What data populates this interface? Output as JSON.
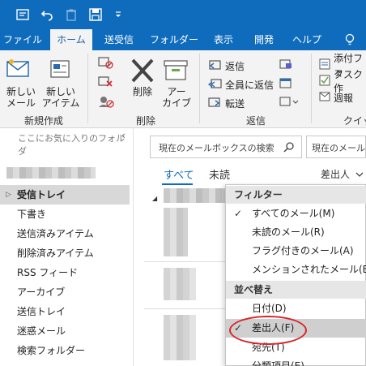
{
  "ribbon_tabs": [
    "ファイル",
    "ホーム",
    "送受信",
    "フォルダー",
    "表示",
    "開発",
    "ヘルプ"
  ],
  "ribbon": {
    "new_mail": "新しい\nメール",
    "new_item": "新しい\nアイテム",
    "group_new": "新規作成",
    "delete": "削除",
    "archive": "アー\nカイブ",
    "group_delete": "削除",
    "reply": "返信",
    "reply_all": "全員に返信",
    "forward": "転送",
    "group_reply": "返信",
    "quick1": "添付ファ",
    "quick2": "タスク作",
    "quick3": "週報",
    "group_quick": "クイッ"
  },
  "nav": {
    "favorites_hint": "ここにお気に入りのフォルダ",
    "inbox": "受信トレイ",
    "folders": [
      "下書き",
      "送信済みアイテム",
      "削除済みアイテム",
      "RSS フィード",
      "アーカイブ",
      "送信トレイ",
      "迷惑メール",
      "検索フォルダー"
    ]
  },
  "search": {
    "placeholder": "現在のメールボックスの検索",
    "scope_placeholder": "現在のメールボ"
  },
  "list": {
    "tab_all": "すべて",
    "tab_unread": "未読",
    "sort_by": "差出人"
  },
  "menu": {
    "filter_header": "フィルター",
    "filter_items": [
      "すべてのメール(M)",
      "未読のメール(R)",
      "フラグ付きのメール(A)",
      "メンションされたメール(E)"
    ],
    "sort_header": "並べ替え",
    "sort_items": [
      "日付(D)",
      "差出人(F)",
      "宛先(T)",
      "分類項目(E)"
    ]
  },
  "colors": {
    "accent": "#0f6cbd",
    "highlight_oval": "#d9252a"
  }
}
